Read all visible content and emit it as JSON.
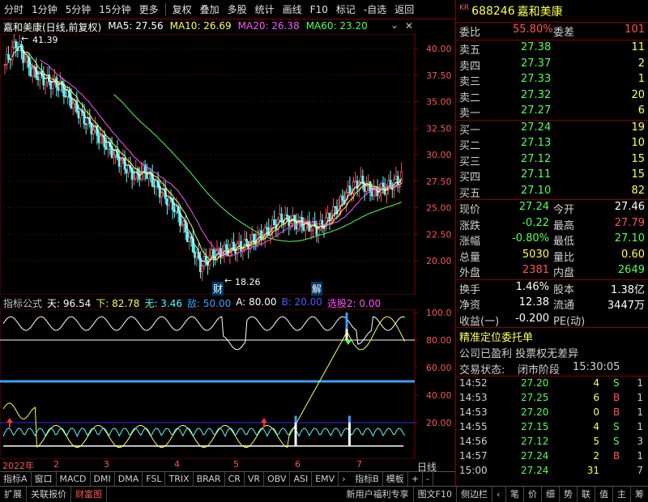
{
  "toolbar": {
    "items": [
      "分时",
      "1分钟",
      "5分钟",
      "15分钟",
      "更多",
      "复权",
      "叠加",
      "多股",
      "统计",
      "画线",
      "F10",
      "标记",
      "-自选",
      "返回"
    ]
  },
  "chart": {
    "name": "嘉和美康(日线,前复权)",
    "ma5": "MA5: 27.56",
    "ma10": "MA10: 26.69",
    "ma20": "MA20: 26.38",
    "ma60": "MA60: 23.20",
    "high_label": "41.39",
    "low_label": "18.26",
    "marker_cai": "财",
    "marker_jie": "解",
    "price_axis": [
      "40.00",
      "37.50",
      "35.00",
      "32.50",
      "30.00",
      "27.50",
      "25.00",
      "22.50",
      "20.00"
    ]
  },
  "indicator": {
    "label": "指标公式",
    "tian": "天: 96.54",
    "xia": "下: 82.78",
    "wu": "无: 3.46",
    "di": "敌: 50.00",
    "a": "A: 80.00",
    "b": "B: 20.00",
    "xuangu": "选股2: 0.00",
    "axis": [
      "100.0",
      "80.00",
      "60.00",
      "40.00",
      "20.00"
    ]
  },
  "time_axis": [
    "2022年",
    "2",
    "3",
    "4",
    "5",
    "6",
    "7"
  ],
  "tabs_row1": [
    "指标A",
    "窗口",
    "MACD",
    "DMI",
    "DMA",
    "FSL",
    "TRIX",
    "BRAR",
    "CR",
    "VR",
    "OBV",
    "ASI",
    "EMV",
    "指标B",
    "模板",
    "+",
    "-"
  ],
  "right_tab": "日线",
  "tabs_row2": [
    "扩展",
    "关联报价",
    "财富图"
  ],
  "tabs_row2_right": [
    "新用户福利专享",
    "图文F10",
    "侧边栏"
  ],
  "right_bottom_tabs": [
    "笔",
    "价",
    "细",
    "势",
    "联",
    "值",
    "主",
    "筹"
  ],
  "stock": {
    "market": "KR",
    "code": "688246",
    "name": "嘉和美康"
  },
  "weibi": {
    "label": "委比",
    "value": "55.80%",
    "label2": "委差",
    "value2": "101"
  },
  "asks": [
    {
      "label": "卖五",
      "price": "27.38",
      "vol": "11"
    },
    {
      "label": "卖四",
      "price": "27.37",
      "vol": "2"
    },
    {
      "label": "卖三",
      "price": "27.33",
      "vol": "1"
    },
    {
      "label": "卖二",
      "price": "27.32",
      "vol": "20"
    },
    {
      "label": "卖一",
      "price": "27.27",
      "vol": "6"
    }
  ],
  "bids": [
    {
      "label": "买一",
      "price": "27.24",
      "vol": "19"
    },
    {
      "label": "买二",
      "price": "27.13",
      "vol": "10"
    },
    {
      "label": "买三",
      "price": "27.12",
      "vol": "15"
    },
    {
      "label": "买四",
      "price": "27.11",
      "vol": "15"
    },
    {
      "label": "买五",
      "price": "27.10",
      "vol": "82"
    }
  ],
  "quote": [
    {
      "l1": "现价",
      "v1": "27.24",
      "l2": "今开",
      "v2": "27.46"
    },
    {
      "l1": "涨跌",
      "v1": "-0.22",
      "l2": "最高",
      "v2": "27.79"
    },
    {
      "l1": "涨幅",
      "v1": "-0.80%",
      "l2": "最低",
      "v2": "27.10"
    },
    {
      "l1": "总量",
      "v1": "5030",
      "l2": "量比",
      "v2": "0.60"
    },
    {
      "l1": "外盘",
      "v1": "2381",
      "l2": "内盘",
      "v2": "2649"
    }
  ],
  "fin": [
    {
      "l1": "换手",
      "v1": "1.46%",
      "l2": "股本",
      "v2": "1.38亿"
    },
    {
      "l1": "净资",
      "v1": "12.38",
      "l2": "流通",
      "v2": "3447万"
    },
    {
      "l1": "收益(一)",
      "v1": "-0.200",
      "l2": "PE(动)",
      "v2": ""
    }
  ],
  "notice": {
    "line1": "精准定位委托单",
    "line2": "公司已盈利 投票权无差异",
    "status_label": "交易状态:",
    "status_value": "闭市阶段",
    "status_time": "15:30:05"
  },
  "trades": [
    {
      "time": "14:52",
      "price": "27.20",
      "vol": "4",
      "bs": "S",
      "n": "1"
    },
    {
      "time": "14:53",
      "price": "27.25",
      "vol": "6",
      "bs": "B",
      "n": "1"
    },
    {
      "time": "14:53",
      "price": "27.20",
      "vol": "0",
      "bs": "B",
      "n": "1"
    },
    {
      "time": "14:55",
      "price": "27.15",
      "vol": "4",
      "bs": "S",
      "n": "1"
    },
    {
      "time": "14:56",
      "price": "27.12",
      "vol": "5",
      "bs": "S",
      "n": "3"
    },
    {
      "time": "14:57",
      "price": "27.24",
      "vol": "2",
      "bs": "B",
      "n": "1"
    },
    {
      "time": "15:00",
      "price": "27.24",
      "vol": "31",
      "bs": "",
      "n": "7"
    }
  ],
  "colors": {
    "up": "#ff5454",
    "down": "#54ffff",
    "ma5": "#ffffff",
    "ma10": "#ffff54",
    "ma20": "#ff54ff",
    "ma60": "#54ff54",
    "frame": "#8a0000"
  },
  "icons": [
    "chevron-down-icon",
    "close-icon"
  ]
}
